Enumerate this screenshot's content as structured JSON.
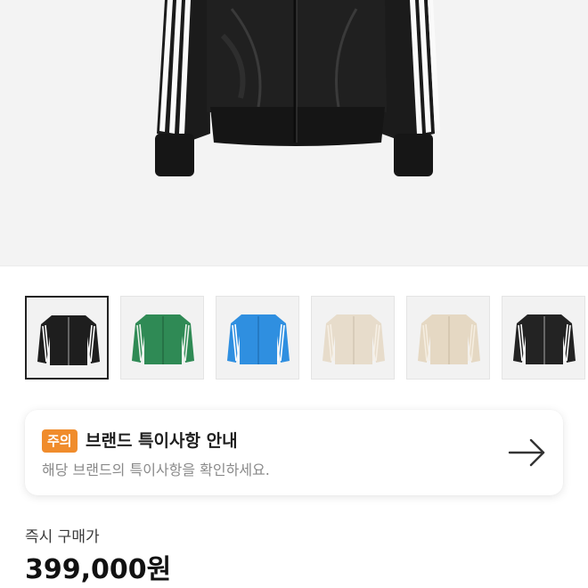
{
  "product": {
    "main_image": "black-track-jacket",
    "thumbnails": [
      {
        "name": "thumb-black-jacket",
        "body": "#1e1e1e",
        "stripe": "#ffffff",
        "selected": true
      },
      {
        "name": "thumb-green-jacket",
        "body": "#2f8a55",
        "stripe": "#e9f2ea",
        "selected": false
      },
      {
        "name": "thumb-blue-jacket",
        "body": "#2f8fe0",
        "stripe": "#ffffff",
        "selected": false
      },
      {
        "name": "thumb-beige-jacket",
        "body": "#e7dccb",
        "stripe": "#f6efe4",
        "selected": false
      },
      {
        "name": "thumb-cream-jacket",
        "body": "#e5d8c3",
        "stripe": "#f5ede0",
        "selected": false
      },
      {
        "name": "thumb-black-jacket-2",
        "body": "#232323",
        "stripe": "#ffffff",
        "selected": false
      }
    ]
  },
  "notice": {
    "badge": "주의",
    "title": "브랜드 특이사항 안내",
    "subtitle": "해당 브랜드의 특이사항을 확인하세요.",
    "arrow_icon": "arrow-right-icon",
    "badge_color": "#f08c2c"
  },
  "price": {
    "label": "즉시 구매가",
    "value": "399,000원"
  }
}
